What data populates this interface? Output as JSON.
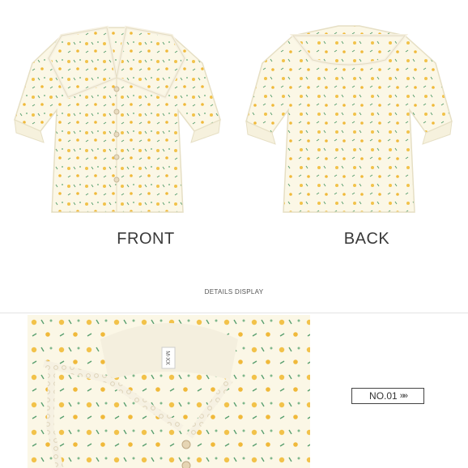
{
  "captions": {
    "front": "FRONT",
    "back": "BACK"
  },
  "section": {
    "label": "DETAILS DISPLAY"
  },
  "badge": {
    "label": "NO.01",
    "arrows": "»»"
  },
  "tag": {
    "text": "M-XX"
  },
  "colors": {
    "fabric": "#fbf7e6",
    "fabric_shadow": "#ece5cc",
    "flower_yellow": "#f2c24a",
    "leaf_green": "#5aa070",
    "lace": "#f6f1e2"
  },
  "icons": {
    "badge_arrows": "chevrons-right-icon"
  }
}
